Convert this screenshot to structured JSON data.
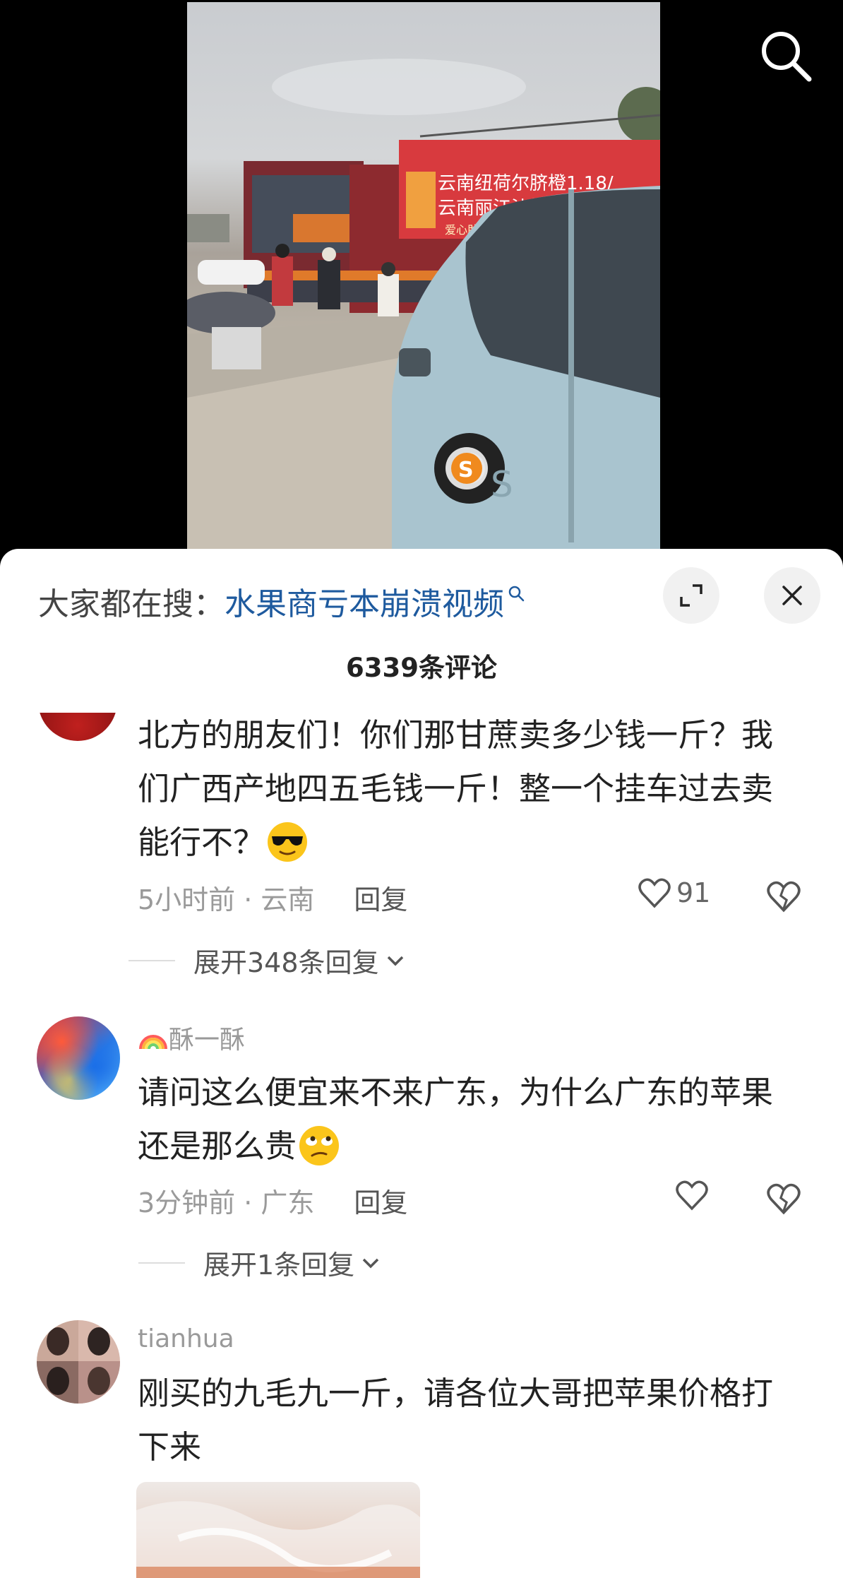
{
  "hot_search": {
    "label": "大家都在搜：",
    "term": "水果商亏本崩溃视频"
  },
  "comment_count": "6339条评论",
  "comments": [
    {
      "text": "北方的朋友们！你们那甘蔗卖多少钱一斤？我们广西产地四五毛钱一斤！整一个挂车过去卖能行不？",
      "emoji": "cool-sunglasses-emoji",
      "time_location": "5小时前 · 云南",
      "reply": "回复",
      "likes": "91",
      "expand": "展开348条回复"
    },
    {
      "username": "酥一酥",
      "username_prefix_icon": "rainbow-emoji",
      "text": "请问这么便宜来不来广东，为什么广东的苹果还是那么贵",
      "emoji": "eye-roll-emoji",
      "time_location": "3分钟前 · 广东",
      "reply": "回复",
      "expand": "展开1条回复"
    },
    {
      "username": "tianhua",
      "text": "刚买的九毛九一斤，请各位大哥把苹果价格打下来"
    }
  ],
  "colors": {
    "link": "#1e5a9e",
    "background": "#ffffff",
    "video_bg": "#000000"
  }
}
